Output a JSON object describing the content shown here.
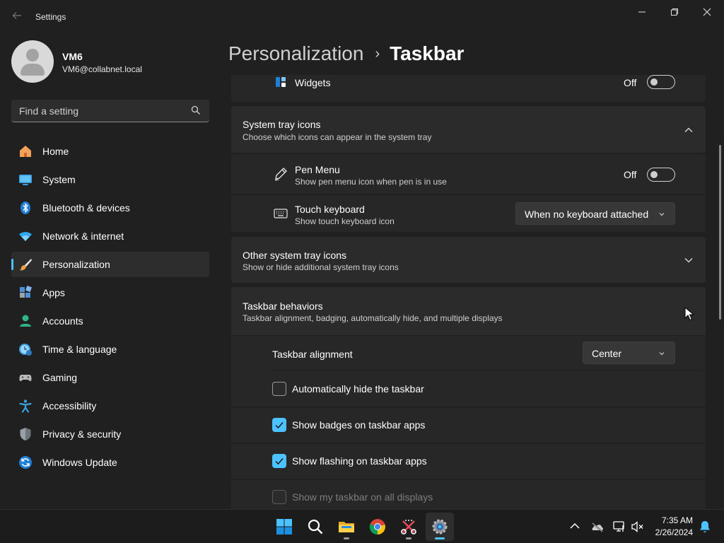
{
  "app": {
    "title": "Settings"
  },
  "profile": {
    "name": "VM6",
    "email": "VM6@collabnet.local"
  },
  "search": {
    "placeholder": "Find a setting"
  },
  "nav": [
    {
      "label": "Home",
      "icon": "home-icon"
    },
    {
      "label": "System",
      "icon": "system-icon"
    },
    {
      "label": "Bluetooth & devices",
      "icon": "bluetooth-icon"
    },
    {
      "label": "Network & internet",
      "icon": "wifi-icon"
    },
    {
      "label": "Personalization",
      "icon": "brush-icon",
      "active": true
    },
    {
      "label": "Apps",
      "icon": "apps-icon"
    },
    {
      "label": "Accounts",
      "icon": "accounts-icon"
    },
    {
      "label": "Time & language",
      "icon": "time-icon"
    },
    {
      "label": "Gaming",
      "icon": "gaming-icon"
    },
    {
      "label": "Accessibility",
      "icon": "accessibility-icon"
    },
    {
      "label": "Privacy & security",
      "icon": "shield-icon"
    },
    {
      "label": "Windows Update",
      "icon": "update-icon"
    }
  ],
  "header": {
    "parent": "Personalization",
    "separator": "›",
    "current": "Taskbar"
  },
  "widgets": {
    "label": "Widgets",
    "state": "Off"
  },
  "system_tray": {
    "title": "System tray icons",
    "desc": "Choose which icons can appear in the system tray",
    "pen_menu": {
      "title": "Pen Menu",
      "desc": "Show pen menu icon when pen is in use",
      "state": "Off"
    },
    "touch_keyboard": {
      "title": "Touch keyboard",
      "desc": "Show touch keyboard icon",
      "value": "When no keyboard attached"
    }
  },
  "other_tray": {
    "title": "Other system tray icons",
    "desc": "Show or hide additional system tray icons"
  },
  "behaviors": {
    "title": "Taskbar behaviors",
    "desc": "Taskbar alignment, badging, automatically hide, and multiple displays",
    "alignment_label": "Taskbar alignment",
    "alignment_value": "Center",
    "auto_hide": "Automatically hide the taskbar",
    "badges": "Show badges on taskbar apps",
    "flashing": "Show flashing on taskbar apps",
    "all_displays": "Show my taskbar on all displays"
  },
  "taskbar": {
    "apps": [
      "start-icon",
      "search-icon",
      "file-explorer-icon",
      "chrome-icon",
      "snipping-tool-icon",
      "settings-icon"
    ],
    "time": "7:35 AM",
    "date": "2/26/2024"
  },
  "colors": {
    "accent": "#4cc2ff",
    "background": "#202020",
    "card": "#2b2b2b"
  }
}
